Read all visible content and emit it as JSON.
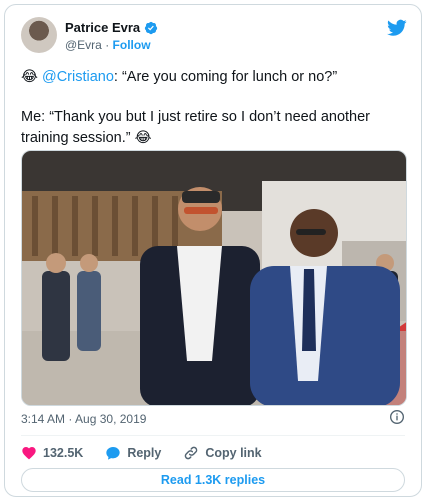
{
  "author": {
    "name": "Patrice Evra",
    "handle": "@Evra",
    "separator": "·",
    "follow_label": "Follow"
  },
  "tweet": {
    "line1_emoji": "😂",
    "line1_mention": "@Cristiano",
    "line1_rest": ": “Are you coming for lunch or no?”",
    "line2_text": "Me: “Thank you but I just retire so I don’t need another training session.”",
    "line2_emoji": "😂"
  },
  "meta": {
    "timestamp": "3:14 AM · Aug 30, 2019"
  },
  "actions": {
    "like_count": "132.5K",
    "reply_label": "Reply",
    "copy_link_label": "Copy link"
  },
  "read_replies_label": "Read 1.3K replies",
  "colors": {
    "accent": "#1d9bf0",
    "like": "#f91880",
    "text": "#0f1419",
    "muted": "#536471"
  },
  "icons": [
    "verified-badge-icon",
    "twitter-bird-icon",
    "info-icon",
    "heart-icon",
    "reply-bubble-icon",
    "link-icon"
  ]
}
